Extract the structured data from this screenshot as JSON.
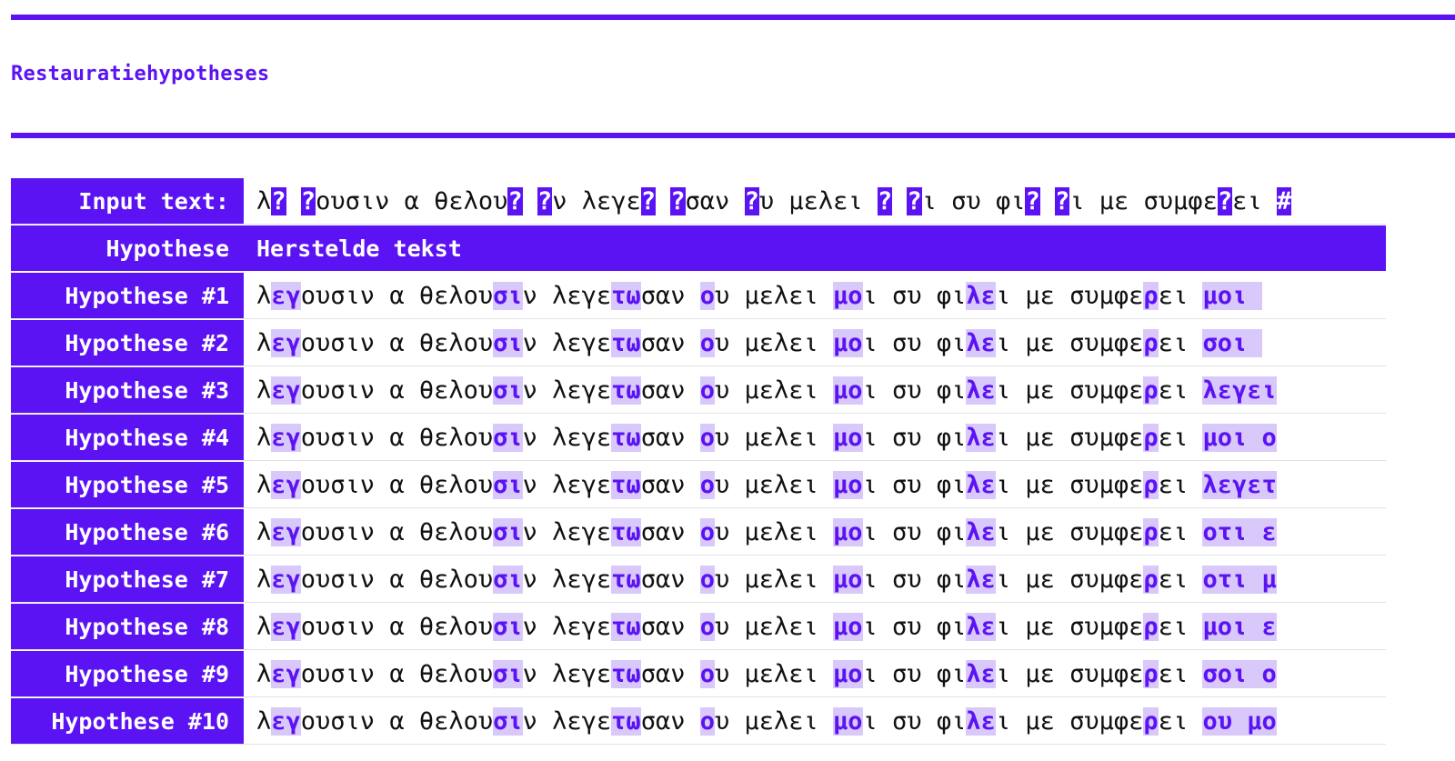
{
  "page": {
    "title": "Restauratiehypotheses"
  },
  "colors": {
    "accent": "#5b13f3",
    "fill_highlight": "#d9c9fb",
    "row_divider": "#e2e2e2"
  },
  "input_row": {
    "label": "Input text:",
    "segments": [
      {
        "t": "λ",
        "k": "plain"
      },
      {
        "t": "?",
        "k": "gap"
      },
      {
        "t": " ",
        "k": "plain"
      },
      {
        "t": "?",
        "k": "gap"
      },
      {
        "t": "ουσιν α θελου",
        "k": "plain"
      },
      {
        "t": "?",
        "k": "gap"
      },
      {
        "t": " ",
        "k": "plain"
      },
      {
        "t": "?",
        "k": "gap"
      },
      {
        "t": "ν λεγε",
        "k": "plain"
      },
      {
        "t": "?",
        "k": "gap"
      },
      {
        "t": " ",
        "k": "plain"
      },
      {
        "t": "?",
        "k": "gap"
      },
      {
        "t": "σαν ",
        "k": "plain"
      },
      {
        "t": "?",
        "k": "gap"
      },
      {
        "t": "υ μελει ",
        "k": "plain"
      },
      {
        "t": "?",
        "k": "gap"
      },
      {
        "t": " ",
        "k": "plain"
      },
      {
        "t": "?",
        "k": "gap"
      },
      {
        "t": "ι συ φι",
        "k": "plain"
      },
      {
        "t": "?",
        "k": "gap"
      },
      {
        "t": " ",
        "k": "plain"
      },
      {
        "t": "?",
        "k": "gap"
      },
      {
        "t": "ι με συμφε",
        "k": "plain"
      },
      {
        "t": "?",
        "k": "gap"
      },
      {
        "t": "ει ",
        "k": "plain"
      },
      {
        "t": "#",
        "k": "gap"
      }
    ]
  },
  "header_row": {
    "label": "Hypothese",
    "text": "Herstelde tekst"
  },
  "hypotheses": [
    {
      "label": "Hypothese #1",
      "segments": [
        {
          "t": "λ",
          "k": "plain"
        },
        {
          "t": "εγ",
          "k": "fill"
        },
        {
          "t": "ουσιν α θελου",
          "k": "plain"
        },
        {
          "t": "σι",
          "k": "fill"
        },
        {
          "t": "ν λεγε",
          "k": "plain"
        },
        {
          "t": "τω",
          "k": "fill"
        },
        {
          "t": "σαν ",
          "k": "plain"
        },
        {
          "t": "ο",
          "k": "fill"
        },
        {
          "t": "υ μελει ",
          "k": "plain"
        },
        {
          "t": "μο",
          "k": "fill"
        },
        {
          "t": "ι συ φι",
          "k": "plain"
        },
        {
          "t": "λε",
          "k": "fill"
        },
        {
          "t": "ι με συμφε",
          "k": "plain"
        },
        {
          "t": "ρ",
          "k": "fill"
        },
        {
          "t": "ει ",
          "k": "plain"
        },
        {
          "t": "μοι ",
          "k": "fill"
        }
      ]
    },
    {
      "label": "Hypothese #2",
      "segments": [
        {
          "t": "λ",
          "k": "plain"
        },
        {
          "t": "εγ",
          "k": "fill"
        },
        {
          "t": "ουσιν α θελου",
          "k": "plain"
        },
        {
          "t": "σι",
          "k": "fill"
        },
        {
          "t": "ν λεγε",
          "k": "plain"
        },
        {
          "t": "τω",
          "k": "fill"
        },
        {
          "t": "σαν ",
          "k": "plain"
        },
        {
          "t": "ο",
          "k": "fill"
        },
        {
          "t": "υ μελει ",
          "k": "plain"
        },
        {
          "t": "μο",
          "k": "fill"
        },
        {
          "t": "ι συ φι",
          "k": "plain"
        },
        {
          "t": "λε",
          "k": "fill"
        },
        {
          "t": "ι με συμφε",
          "k": "plain"
        },
        {
          "t": "ρ",
          "k": "fill"
        },
        {
          "t": "ει ",
          "k": "plain"
        },
        {
          "t": "σοι ",
          "k": "fill"
        }
      ]
    },
    {
      "label": "Hypothese #3",
      "segments": [
        {
          "t": "λ",
          "k": "plain"
        },
        {
          "t": "εγ",
          "k": "fill"
        },
        {
          "t": "ουσιν α θελου",
          "k": "plain"
        },
        {
          "t": "σι",
          "k": "fill"
        },
        {
          "t": "ν λεγε",
          "k": "plain"
        },
        {
          "t": "τω",
          "k": "fill"
        },
        {
          "t": "σαν ",
          "k": "plain"
        },
        {
          "t": "ο",
          "k": "fill"
        },
        {
          "t": "υ μελει ",
          "k": "plain"
        },
        {
          "t": "μο",
          "k": "fill"
        },
        {
          "t": "ι συ φι",
          "k": "plain"
        },
        {
          "t": "λε",
          "k": "fill"
        },
        {
          "t": "ι με συμφε",
          "k": "plain"
        },
        {
          "t": "ρ",
          "k": "fill"
        },
        {
          "t": "ει ",
          "k": "plain"
        },
        {
          "t": "λεγει",
          "k": "fill"
        }
      ]
    },
    {
      "label": "Hypothese #4",
      "segments": [
        {
          "t": "λ",
          "k": "plain"
        },
        {
          "t": "εγ",
          "k": "fill"
        },
        {
          "t": "ουσιν α θελου",
          "k": "plain"
        },
        {
          "t": "σι",
          "k": "fill"
        },
        {
          "t": "ν λεγε",
          "k": "plain"
        },
        {
          "t": "τω",
          "k": "fill"
        },
        {
          "t": "σαν ",
          "k": "plain"
        },
        {
          "t": "ο",
          "k": "fill"
        },
        {
          "t": "υ μελει ",
          "k": "plain"
        },
        {
          "t": "μο",
          "k": "fill"
        },
        {
          "t": "ι συ φι",
          "k": "plain"
        },
        {
          "t": "λε",
          "k": "fill"
        },
        {
          "t": "ι με συμφε",
          "k": "plain"
        },
        {
          "t": "ρ",
          "k": "fill"
        },
        {
          "t": "ει ",
          "k": "plain"
        },
        {
          "t": "μοι ο",
          "k": "fill"
        }
      ]
    },
    {
      "label": "Hypothese #5",
      "segments": [
        {
          "t": "λ",
          "k": "plain"
        },
        {
          "t": "εγ",
          "k": "fill"
        },
        {
          "t": "ουσιν α θελου",
          "k": "plain"
        },
        {
          "t": "σι",
          "k": "fill"
        },
        {
          "t": "ν λεγε",
          "k": "plain"
        },
        {
          "t": "τω",
          "k": "fill"
        },
        {
          "t": "σαν ",
          "k": "plain"
        },
        {
          "t": "ο",
          "k": "fill"
        },
        {
          "t": "υ μελει ",
          "k": "plain"
        },
        {
          "t": "μο",
          "k": "fill"
        },
        {
          "t": "ι συ φι",
          "k": "plain"
        },
        {
          "t": "λε",
          "k": "fill"
        },
        {
          "t": "ι με συμφε",
          "k": "plain"
        },
        {
          "t": "ρ",
          "k": "fill"
        },
        {
          "t": "ει ",
          "k": "plain"
        },
        {
          "t": "λεγετ",
          "k": "fill"
        }
      ]
    },
    {
      "label": "Hypothese #6",
      "segments": [
        {
          "t": "λ",
          "k": "plain"
        },
        {
          "t": "εγ",
          "k": "fill"
        },
        {
          "t": "ουσιν α θελου",
          "k": "plain"
        },
        {
          "t": "σι",
          "k": "fill"
        },
        {
          "t": "ν λεγε",
          "k": "plain"
        },
        {
          "t": "τω",
          "k": "fill"
        },
        {
          "t": "σαν ",
          "k": "plain"
        },
        {
          "t": "ο",
          "k": "fill"
        },
        {
          "t": "υ μελει ",
          "k": "plain"
        },
        {
          "t": "μο",
          "k": "fill"
        },
        {
          "t": "ι συ φι",
          "k": "plain"
        },
        {
          "t": "λε",
          "k": "fill"
        },
        {
          "t": "ι με συμφε",
          "k": "plain"
        },
        {
          "t": "ρ",
          "k": "fill"
        },
        {
          "t": "ει ",
          "k": "plain"
        },
        {
          "t": "οτι ε",
          "k": "fill"
        }
      ]
    },
    {
      "label": "Hypothese #7",
      "segments": [
        {
          "t": "λ",
          "k": "plain"
        },
        {
          "t": "εγ",
          "k": "fill"
        },
        {
          "t": "ουσιν α θελου",
          "k": "plain"
        },
        {
          "t": "σι",
          "k": "fill"
        },
        {
          "t": "ν λεγε",
          "k": "plain"
        },
        {
          "t": "τω",
          "k": "fill"
        },
        {
          "t": "σαν ",
          "k": "plain"
        },
        {
          "t": "ο",
          "k": "fill"
        },
        {
          "t": "υ μελει ",
          "k": "plain"
        },
        {
          "t": "μο",
          "k": "fill"
        },
        {
          "t": "ι συ φι",
          "k": "plain"
        },
        {
          "t": "λε",
          "k": "fill"
        },
        {
          "t": "ι με συμφε",
          "k": "plain"
        },
        {
          "t": "ρ",
          "k": "fill"
        },
        {
          "t": "ει ",
          "k": "plain"
        },
        {
          "t": "οτι μ",
          "k": "fill"
        }
      ]
    },
    {
      "label": "Hypothese #8",
      "segments": [
        {
          "t": "λ",
          "k": "plain"
        },
        {
          "t": "εγ",
          "k": "fill"
        },
        {
          "t": "ουσιν α θελου",
          "k": "plain"
        },
        {
          "t": "σι",
          "k": "fill"
        },
        {
          "t": "ν λεγε",
          "k": "plain"
        },
        {
          "t": "τω",
          "k": "fill"
        },
        {
          "t": "σαν ",
          "k": "plain"
        },
        {
          "t": "ο",
          "k": "fill"
        },
        {
          "t": "υ μελει ",
          "k": "plain"
        },
        {
          "t": "μο",
          "k": "fill"
        },
        {
          "t": "ι συ φι",
          "k": "plain"
        },
        {
          "t": "λε",
          "k": "fill"
        },
        {
          "t": "ι με συμφε",
          "k": "plain"
        },
        {
          "t": "ρ",
          "k": "fill"
        },
        {
          "t": "ει ",
          "k": "plain"
        },
        {
          "t": "μοι ε",
          "k": "fill"
        }
      ]
    },
    {
      "label": "Hypothese #9",
      "segments": [
        {
          "t": "λ",
          "k": "plain"
        },
        {
          "t": "εγ",
          "k": "fill"
        },
        {
          "t": "ουσιν α θελου",
          "k": "plain"
        },
        {
          "t": "σι",
          "k": "fill"
        },
        {
          "t": "ν λεγε",
          "k": "plain"
        },
        {
          "t": "τω",
          "k": "fill"
        },
        {
          "t": "σαν ",
          "k": "plain"
        },
        {
          "t": "ο",
          "k": "fill"
        },
        {
          "t": "υ μελει ",
          "k": "plain"
        },
        {
          "t": "μο",
          "k": "fill"
        },
        {
          "t": "ι συ φι",
          "k": "plain"
        },
        {
          "t": "λε",
          "k": "fill"
        },
        {
          "t": "ι με συμφε",
          "k": "plain"
        },
        {
          "t": "ρ",
          "k": "fill"
        },
        {
          "t": "ει ",
          "k": "plain"
        },
        {
          "t": "σοι ο",
          "k": "fill"
        }
      ]
    },
    {
      "label": "Hypothese #10",
      "segments": [
        {
          "t": "λ",
          "k": "plain"
        },
        {
          "t": "εγ",
          "k": "fill"
        },
        {
          "t": "ουσιν α θελου",
          "k": "plain"
        },
        {
          "t": "σι",
          "k": "fill"
        },
        {
          "t": "ν λεγε",
          "k": "plain"
        },
        {
          "t": "τω",
          "k": "fill"
        },
        {
          "t": "σαν ",
          "k": "plain"
        },
        {
          "t": "ο",
          "k": "fill"
        },
        {
          "t": "υ μελει ",
          "k": "plain"
        },
        {
          "t": "μο",
          "k": "fill"
        },
        {
          "t": "ι συ φι",
          "k": "plain"
        },
        {
          "t": "λε",
          "k": "fill"
        },
        {
          "t": "ι με συμφε",
          "k": "plain"
        },
        {
          "t": "ρ",
          "k": "fill"
        },
        {
          "t": "ει ",
          "k": "plain"
        },
        {
          "t": "ου μο",
          "k": "fill"
        }
      ]
    }
  ]
}
